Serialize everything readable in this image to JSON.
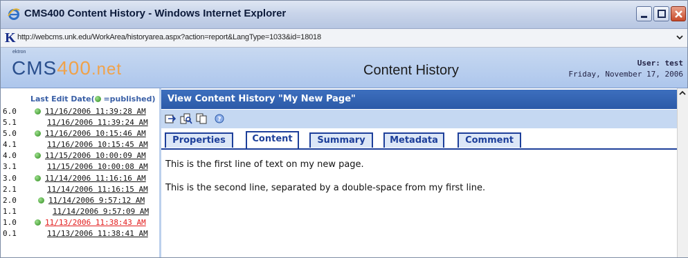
{
  "window": {
    "title": "CMS400 Content History - Windows Internet Explorer",
    "url": "http://webcms.unk.edu/WorkArea/historyarea.aspx?action=report&LangType=1033&id=18018"
  },
  "header": {
    "logo_small": "ektron",
    "logo_cms": "CMS",
    "logo_400": "400",
    "logo_net": ".net",
    "title": "Content History",
    "user": "User: test",
    "date": "Friday, November 17, 2006"
  },
  "history": {
    "header_label_prefix": "Last Edit Date(",
    "header_label_suffix": "=published)",
    "rows": [
      {
        "version": "6.0",
        "date": "11/16/2006 11:39:28 AM",
        "published": true
      },
      {
        "version": "5.1",
        "date": "11/16/2006 11:39:24 AM",
        "published": false
      },
      {
        "version": "5.0",
        "date": "11/16/2006 10:15:46 AM",
        "published": true
      },
      {
        "version": "4.1",
        "date": "11/16/2006 10:15:45 AM",
        "published": false
      },
      {
        "version": "4.0",
        "date": "11/15/2006 10:00:09 AM",
        "published": true
      },
      {
        "version": "3.1",
        "date": "11/15/2006 10:00:08 AM",
        "published": false
      },
      {
        "version": "3.0",
        "date": "11/14/2006 11:16:16 AM",
        "published": true
      },
      {
        "version": "2.1",
        "date": "11/14/2006 11:16:15 AM",
        "published": false
      },
      {
        "version": "2.0",
        "date": "11/14/2006 9:57:12 AM",
        "published": true
      },
      {
        "version": "1.1",
        "date": "11/14/2006 9:57:09 AM",
        "published": false
      },
      {
        "version": "1.0",
        "date": "11/13/2006 11:38:43 AM",
        "published": true,
        "active": true
      },
      {
        "version": "0.1",
        "date": "11/13/2006 11:38:41 AM",
        "published": false
      }
    ]
  },
  "view": {
    "title": "View Content History \"My New Page\"",
    "toolbar_icons": [
      "restore-icon",
      "compare-icon",
      "copy-icon",
      "help-icon"
    ],
    "tabs": [
      {
        "label": "Properties"
      },
      {
        "label": "Content"
      },
      {
        "label": "Summary"
      },
      {
        "label": "Metadata"
      },
      {
        "label": "Comment"
      }
    ],
    "selected_tab": "Content",
    "content": {
      "line1": "This is the first line of text on my new page.",
      "line2": "This is the second line, separated by a double-space from my first line."
    }
  },
  "colors": {
    "accent": "#2c5aa8",
    "header_bg": "#adc6ec",
    "active_row": "#e21b1b",
    "published_dot": "#2c8a1c"
  }
}
